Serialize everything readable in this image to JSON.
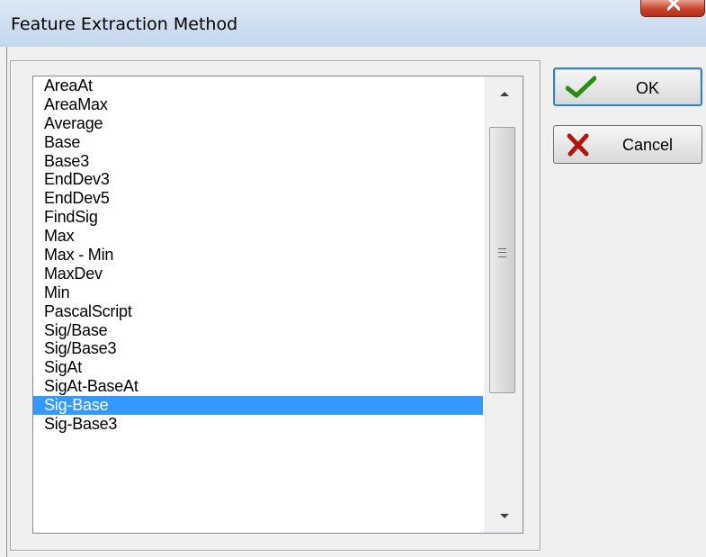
{
  "window": {
    "title": "Feature Extraction Method",
    "close_icon": "close-icon"
  },
  "list": {
    "items": [
      "AreaAt",
      "AreaMax",
      "Average",
      "Base",
      "Base3",
      "EndDev3",
      "EndDev5",
      "FindSig",
      "Max",
      "Max - Min",
      "MaxDev",
      "Min",
      "PascalScript",
      "Sig/Base",
      "Sig/Base3",
      "SigAt",
      "SigAt-BaseAt",
      "Sig-Base",
      "Sig-Base3"
    ],
    "selected": "Sig-Base"
  },
  "buttons": {
    "ok": {
      "label": "OK",
      "icon": "checkmark-icon"
    },
    "cancel": {
      "label": "Cancel",
      "icon": "x-cross-icon"
    }
  },
  "colors": {
    "selection": "#3399ff",
    "ok_check": "#2f8a15",
    "cancel_x": "#b3150e"
  }
}
